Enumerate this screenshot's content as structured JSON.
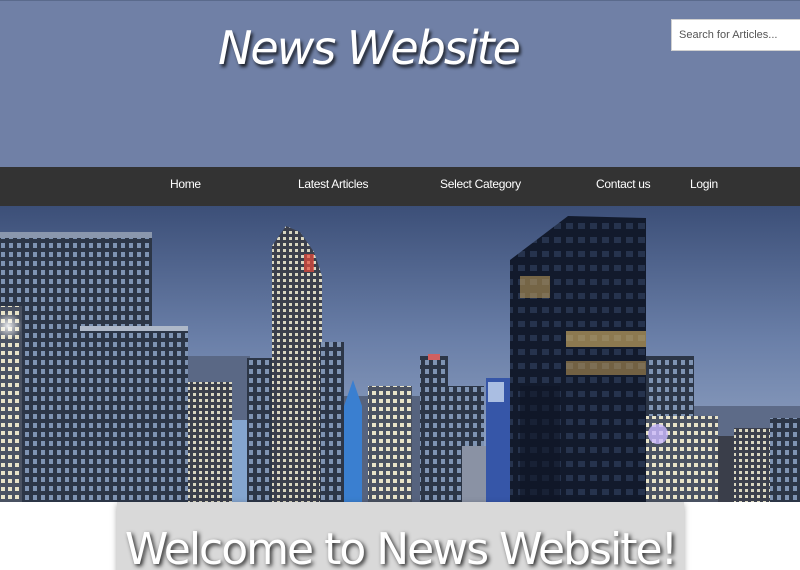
{
  "header": {
    "site_title": "News Website",
    "search_placeholder": "Search for Articles..."
  },
  "nav": {
    "items": [
      {
        "label": "Home"
      },
      {
        "label": "Latest Articles"
      },
      {
        "label": "Select Category"
      },
      {
        "label": "Contact us"
      },
      {
        "label": "Login"
      }
    ]
  },
  "hero": {
    "image": "city-skyline-night"
  },
  "welcome": {
    "heading": "Welcome to News Website!"
  },
  "colors": {
    "header_bg": "#7080a6",
    "nav_bg": "#333333",
    "welcome_bg": "#d9d9d9",
    "title_text": "#ffffff"
  }
}
